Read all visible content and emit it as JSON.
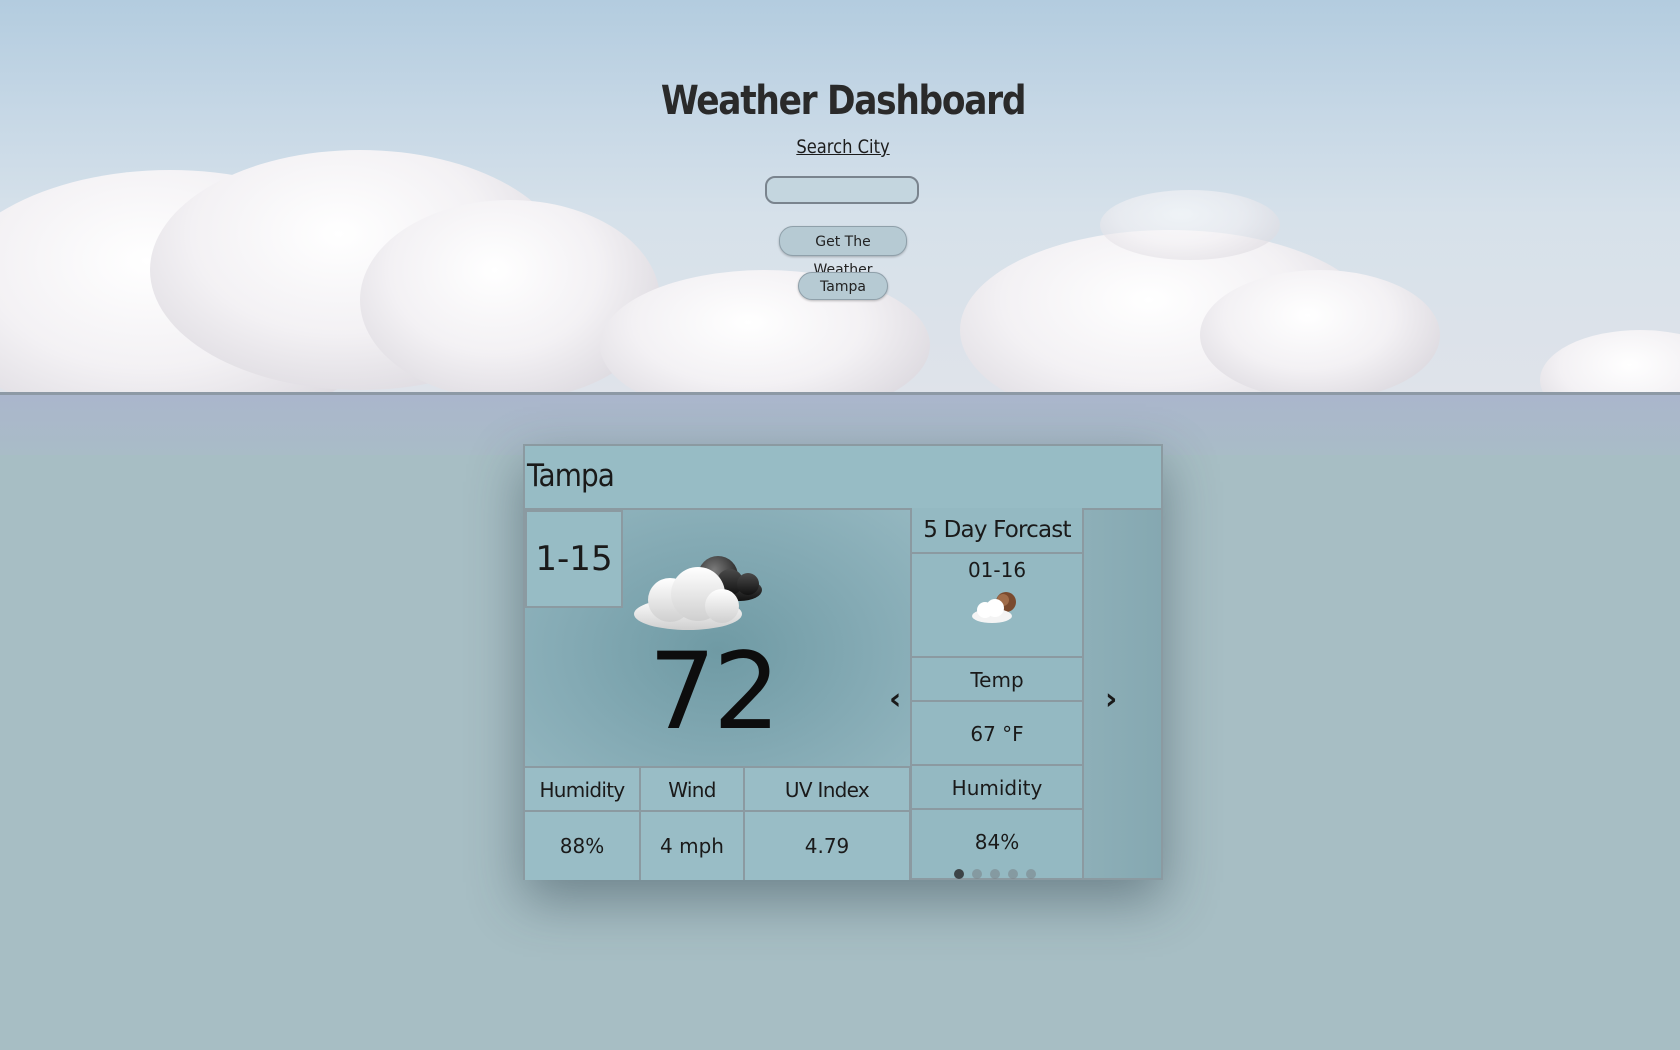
{
  "header": {
    "title": "Weather Dashboard",
    "search_label": "Search City",
    "search_value": "",
    "search_placeholder": "",
    "get_weather_label": "Get The Weather",
    "history": [
      "Tampa"
    ]
  },
  "current": {
    "city": "Tampa",
    "date": "1-15",
    "icon": "partly-cloudy-night-icon",
    "temperature": "72 °F",
    "humidity_label": "Humidity",
    "humidity": "88%",
    "wind_label": "Wind Speed",
    "wind": "4 mph",
    "uv_label": "UV Index",
    "uv": "4.79"
  },
  "forecast": {
    "title": "5 Day Forcast",
    "date": "01-16",
    "icon": "partly-cloudy-night-icon",
    "temp_label": "Temp",
    "temp": "67 °F",
    "humidity_label": "Humidity",
    "humidity": "84%",
    "prev_label": "‹",
    "next_label": "›",
    "page_count": 5,
    "active_page": 1
  },
  "colors": {
    "card_bg": "#97bcc5",
    "page_bg": "#a7bec4",
    "sky_top": "#b3ccdf"
  }
}
